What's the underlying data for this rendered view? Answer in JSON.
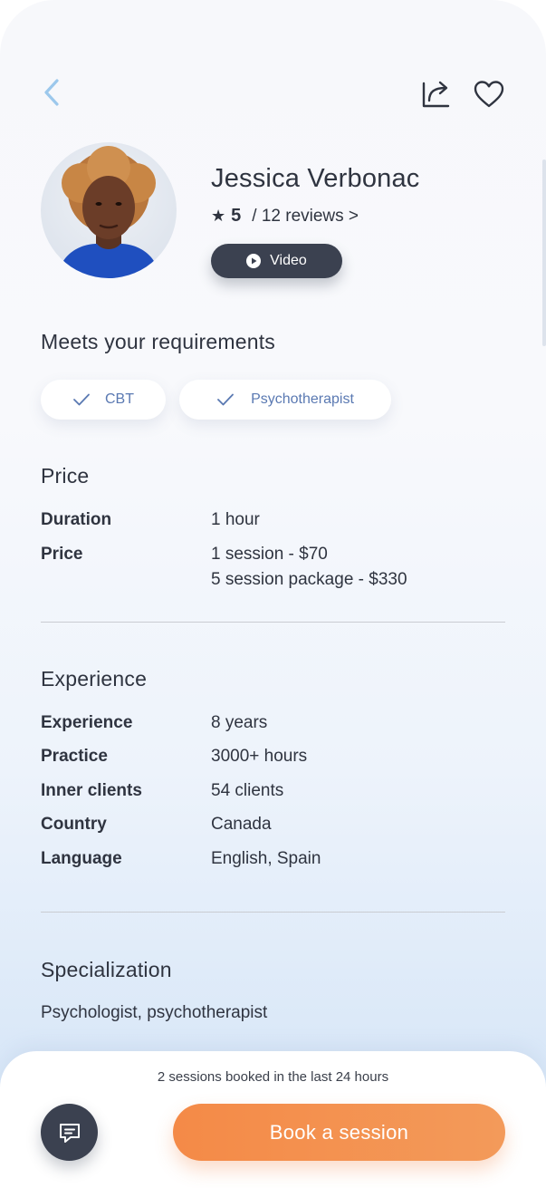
{
  "colors": {
    "accent_orange": "#f48a47",
    "dark_button": "#3b4150",
    "back_arrow": "#9cc8ec",
    "chip_text": "#5a79b2"
  },
  "header": {
    "back_icon": "chevron-left-icon",
    "share_icon": "share-icon",
    "favorite_icon": "heart-icon"
  },
  "profile": {
    "name": "Jessica Verbonac",
    "rating_star": "★",
    "rating_score": "5",
    "reviews_text": "/ 12 reviews >",
    "video_label": "Video"
  },
  "requirements": {
    "title": "Meets your requirements",
    "chips": [
      "CBT",
      "Psychotherapist"
    ]
  },
  "price": {
    "title": "Price",
    "rows": [
      {
        "label": "Duration",
        "value": "1 hour"
      },
      {
        "label": "Price",
        "value": "1 session - $70",
        "value2": "5 session package - $330"
      }
    ]
  },
  "experience": {
    "title": "Experience",
    "rows": [
      {
        "label": "Experience",
        "value": "8 years"
      },
      {
        "label": "Practice",
        "value": "3000+ hours"
      },
      {
        "label": "Inner clients",
        "value": "54 clients"
      },
      {
        "label": "Country",
        "value": "Canada"
      },
      {
        "label": "Language",
        "value": "English, Spain"
      }
    ]
  },
  "specialization": {
    "title": "Specialization",
    "text": "Psychologist, psychotherapist"
  },
  "footer": {
    "booked_note": "2 sessions booked in the last 24 hours",
    "chat_icon": "chat-icon",
    "book_label": "Book a session"
  }
}
